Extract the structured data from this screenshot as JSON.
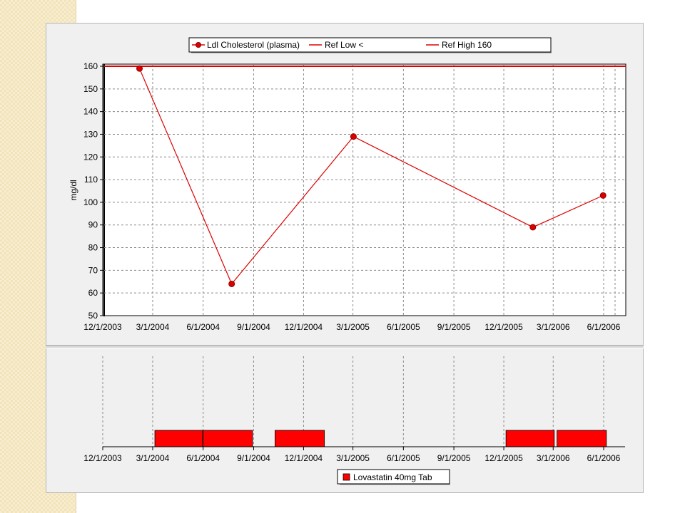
{
  "colors": {
    "series": "#dd0000",
    "ref": "#e00000",
    "bar": "#ff0000",
    "marker_edge": "#8b0000",
    "grid": "#8a8a8a",
    "panel_bg": "#f0f0f0",
    "plot_bg": "#ffffff",
    "deco": "#f3e3b9"
  },
  "legend_top": {
    "items": [
      {
        "label": "Ldl Cholesterol (plasma)",
        "marker": "circle"
      },
      {
        "label": "Ref Low <",
        "marker": "line"
      },
      {
        "label": "Ref High 160",
        "marker": "line"
      }
    ]
  },
  "legend_bottom": {
    "items": [
      {
        "label": "Lovastatin 40mg Tab",
        "marker": "square"
      }
    ]
  },
  "chart_data": [
    {
      "type": "line",
      "title": "",
      "xlabel": "",
      "ylabel": "mg/dl",
      "ylim": [
        50,
        160
      ],
      "yticks": [
        50,
        60,
        70,
        80,
        90,
        100,
        110,
        120,
        130,
        140,
        150,
        160
      ],
      "xlim": [
        "2003-12-01",
        "2006-06-01"
      ],
      "xticks": [
        "12/1/2003",
        "3/1/2004",
        "6/1/2004",
        "9/1/2004",
        "12/1/2004",
        "3/1/2005",
        "6/1/2005",
        "9/1/2005",
        "12/1/2005",
        "3/1/2006",
        "6/1/2006"
      ],
      "grid": true,
      "legend": "top",
      "series": [
        {
          "name": "Ldl Cholesterol (plasma)",
          "x": [
            "2004-02-06",
            "2004-07-23",
            "2005-03-02",
            "2006-01-23",
            "2006-05-31"
          ],
          "values": [
            159,
            64,
            129,
            89,
            103
          ]
        }
      ],
      "ref_lines": [
        {
          "name": "Ref High 160",
          "value": 160
        }
      ]
    },
    {
      "type": "bar",
      "title": "",
      "xlabel": "",
      "ylabel": "",
      "xlim": [
        "2003-12-01",
        "2006-06-01"
      ],
      "xticks": [
        "12/1/2003",
        "3/1/2004",
        "6/1/2004",
        "9/1/2004",
        "12/1/2004",
        "3/1/2005",
        "6/1/2005",
        "9/1/2005",
        "12/1/2005",
        "3/1/2006",
        "6/1/2006"
      ],
      "grid": true,
      "legend": "bottom",
      "series": [
        {
          "name": "Lovastatin 40mg Tab",
          "intervals": [
            {
              "start": "2004-03-05",
              "end": "2004-05-31"
            },
            {
              "start": "2004-06-01",
              "end": "2004-08-30"
            },
            {
              "start": "2004-10-10",
              "end": "2005-01-08"
            },
            {
              "start": "2005-12-05",
              "end": "2006-03-03"
            },
            {
              "start": "2006-03-08",
              "end": "2006-06-06"
            }
          ]
        }
      ]
    }
  ]
}
